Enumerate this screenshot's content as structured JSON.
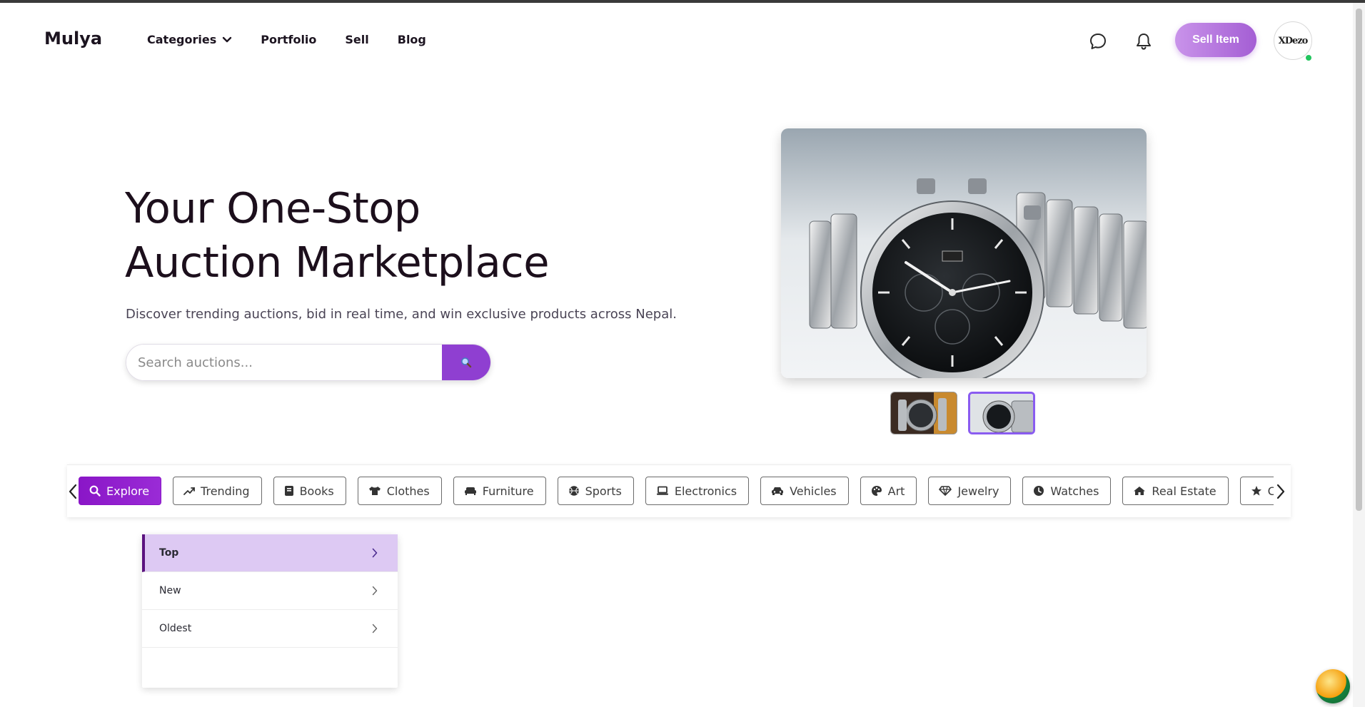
{
  "header": {
    "logo": "Mulya",
    "nav": [
      {
        "label": "Categories",
        "has_dropdown": true
      },
      {
        "label": "Portfolio"
      },
      {
        "label": "Sell"
      },
      {
        "label": "Blog"
      }
    ],
    "sell_button": "Sell Item",
    "avatar_text": "XDezo",
    "icons": [
      "chat-bubble-icon",
      "bell-icon"
    ]
  },
  "hero": {
    "title_line1": "Your One-Stop",
    "title_line2": "Auction Marketplace",
    "subtitle": "Discover trending auctions, bid in real time, and win exclusive products across Nepal.",
    "search_placeholder": "Search auctions...",
    "search_button_icon": "🔍"
  },
  "gallery": {
    "thumbnails": [
      {
        "active": false
      },
      {
        "active": true
      }
    ]
  },
  "categories": [
    {
      "label": "Explore",
      "icon": "search-icon",
      "active": true
    },
    {
      "label": "Trending",
      "icon": "trending-icon"
    },
    {
      "label": "Books",
      "icon": "book-icon"
    },
    {
      "label": "Clothes",
      "icon": "shirt-icon"
    },
    {
      "label": "Furniture",
      "icon": "couch-icon"
    },
    {
      "label": "Sports",
      "icon": "ball-icon"
    },
    {
      "label": "Electronics",
      "icon": "laptop-icon"
    },
    {
      "label": "Vehicles",
      "icon": "car-icon"
    },
    {
      "label": "Art",
      "icon": "palette-icon"
    },
    {
      "label": "Jewelry",
      "icon": "gem-icon"
    },
    {
      "label": "Watches",
      "icon": "clock-icon"
    },
    {
      "label": "Real Estate",
      "icon": "house-icon"
    },
    {
      "label": "Collectibles",
      "icon": "star-icon"
    }
  ],
  "sort": {
    "options": [
      {
        "label": "Top",
        "active": true
      },
      {
        "label": "New"
      },
      {
        "label": "Oldest"
      }
    ]
  },
  "colors": {
    "accent": "#8f3fd1",
    "active_chip": "#8a16c7",
    "sort_active_bg": "#ddc9f3"
  }
}
